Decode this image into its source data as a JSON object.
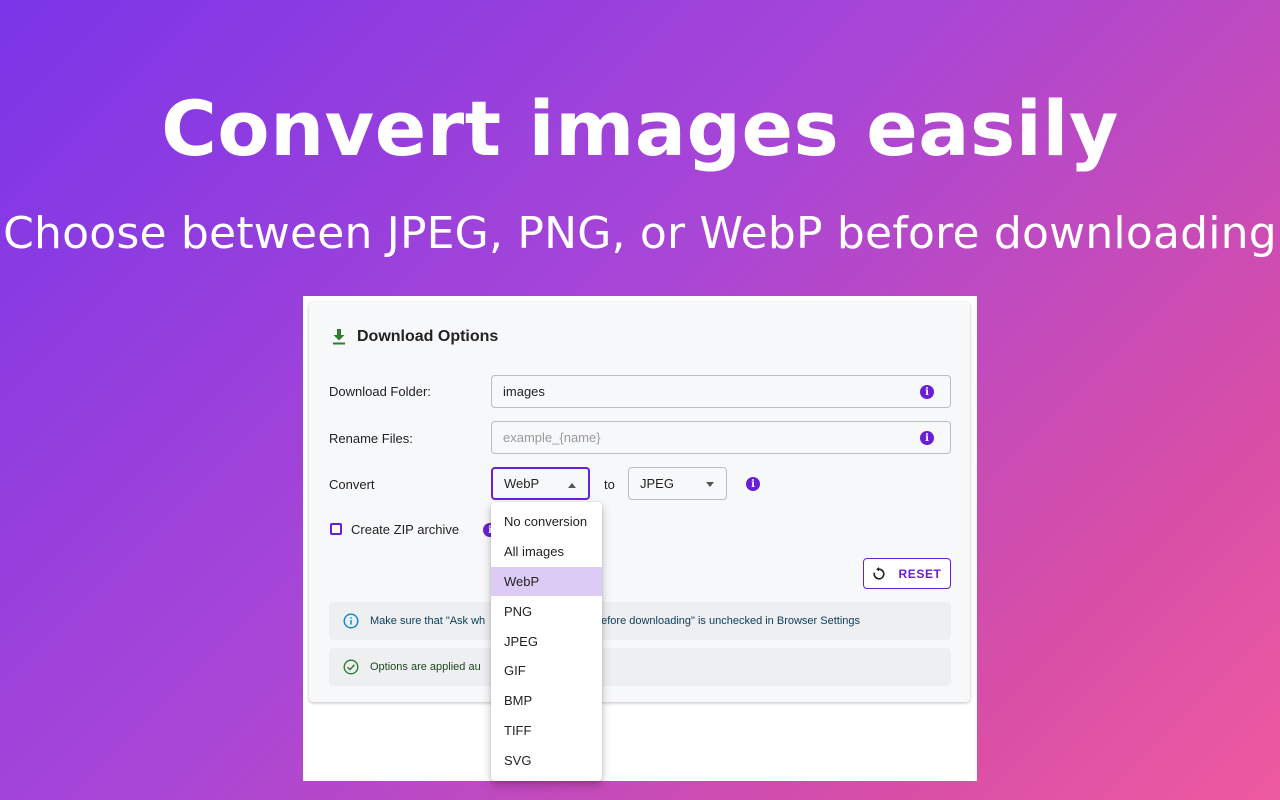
{
  "hero": {
    "title": "Convert images easily",
    "subtitle": "Choose between JPEG, PNG, or WebP before downloading"
  },
  "panel": {
    "title": "Download Options",
    "download_folder": {
      "label": "Download Folder:",
      "value": "images"
    },
    "rename_files": {
      "label": "Rename Files:",
      "placeholder": "example_{name}"
    },
    "convert": {
      "label": "Convert",
      "from_value": "WebP",
      "to_label": "to",
      "to_value": "JPEG",
      "options": [
        "No conversion",
        "All images",
        "WebP",
        "PNG",
        "JPEG",
        "GIF",
        "BMP",
        "TIFF",
        "SVG"
      ],
      "selected_option": "WebP"
    },
    "zip": {
      "label": "Create ZIP archive",
      "checked": false
    },
    "reset_label": "RESET",
    "alerts": {
      "info_left": "Make sure that \"Ask wh",
      "info_right": "before downloading\" is unchecked in Browser Settings",
      "success_left": "Options are applied au"
    }
  },
  "colors": {
    "accent": "#6a1fd6",
    "download_icon": "#2e7d32",
    "info_alert_icon": "#0288d1",
    "success_alert_icon": "#2e7d32",
    "selected_option_bg": "#dccbf5"
  }
}
